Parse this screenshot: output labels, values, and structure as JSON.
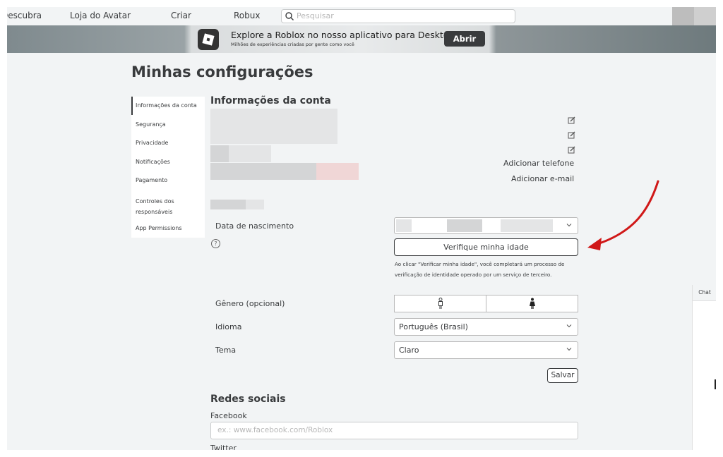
{
  "nav": {
    "links": [
      "Descubra",
      "Loja do Avatar",
      "Criar",
      "Robux"
    ],
    "search_placeholder": "Pesquisar"
  },
  "banner": {
    "title": "Explore a Roblox no nosso aplicativo para Desktop!",
    "subtitle": "Milhões de experiências criadas por gente como você",
    "button": "Abrir"
  },
  "page": {
    "title": "Minhas configurações"
  },
  "sidebar": {
    "items": [
      "Informações da conta",
      "Segurança",
      "Privacidade",
      "Notificações",
      "Pagamento",
      "Controles dos responsáveis",
      "App Permissions"
    ]
  },
  "account": {
    "section_title": "Informações da conta",
    "add_phone": "Adicionar telefone",
    "add_email": "Adicionar e-mail",
    "birthdate_label": "Data de nascimento",
    "verify_button": "Verifique minha idade",
    "verify_note": "Ao clicar \"Verificar minha idade\", você completará um processo de verificação de identidade operado por um serviço de terceiro.",
    "gender_label": "Gênero (opcional)",
    "language_label": "Idioma",
    "language_value": "Português (Brasil)",
    "theme_label": "Tema",
    "theme_value": "Claro",
    "save_button": "Salvar"
  },
  "social": {
    "section_title": "Redes sociais",
    "facebook_label": "Facebook",
    "facebook_placeholder": "ex.: www.facebook.com/Roblox",
    "twitter_label": "Twitter"
  },
  "chat": {
    "tab_label": "Chat"
  },
  "colors": {
    "text": "#393b3d",
    "annotation_arrow": "#d01818",
    "background": "#f2f4f5"
  }
}
